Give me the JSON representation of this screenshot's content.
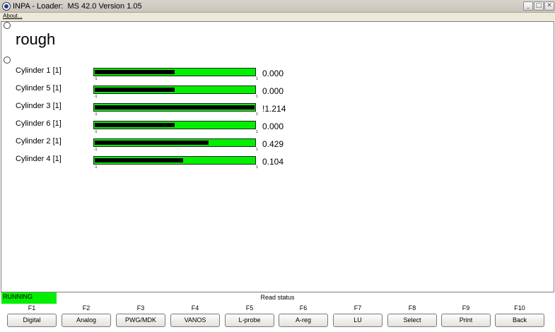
{
  "window": {
    "title": "INPA - Loader:  MS 42.0 Version 1.05",
    "min_glyph": "_",
    "max_glyph": "□",
    "close_glyph": "✕"
  },
  "menu": {
    "about": "About..."
  },
  "main": {
    "heading": "rough",
    "rows": [
      {
        "label": "Cylinder 1 [1]",
        "value": "0.000",
        "level": 0.5,
        "min": "-1",
        "max": "1"
      },
      {
        "label": "Cylinder 5 [1]",
        "value": "0.000",
        "level": 0.5,
        "min": "-1",
        "max": "1"
      },
      {
        "label": "Cylinder 3 [1]",
        "value": "!1.214",
        "level": 1.0,
        "min": "-1",
        "max": "1"
      },
      {
        "label": "Cylinder 6 [1]",
        "value": "0.000",
        "level": 0.5,
        "min": "-1",
        "max": "1"
      },
      {
        "label": "Cylinder 2 [1]",
        "value": "0.429",
        "level": 0.7145,
        "min": "-1",
        "max": "1"
      },
      {
        "label": "Cylinder 4 [1]",
        "value": "0.104",
        "level": 0.552,
        "min": "-1",
        "max": "1"
      }
    ]
  },
  "status": {
    "running": "RUNNING",
    "text": "Read status",
    "running_color": "#00f000"
  },
  "fkeys": [
    {
      "key": "F1",
      "label": "Digital"
    },
    {
      "key": "F2",
      "label": "Analog"
    },
    {
      "key": "F3",
      "label": "PWG/MDK"
    },
    {
      "key": "F4",
      "label": "VANOS"
    },
    {
      "key": "F5",
      "label": "L-probe"
    },
    {
      "key": "F6",
      "label": "A-reg"
    },
    {
      "key": "F7",
      "label": "LU"
    },
    {
      "key": "F8",
      "label": "Select"
    },
    {
      "key": "F9",
      "label": "Print"
    },
    {
      "key": "F10",
      "label": "Back"
    }
  ],
  "colors": {
    "bar_green": "#00f000",
    "bar_fill": "#000000"
  }
}
